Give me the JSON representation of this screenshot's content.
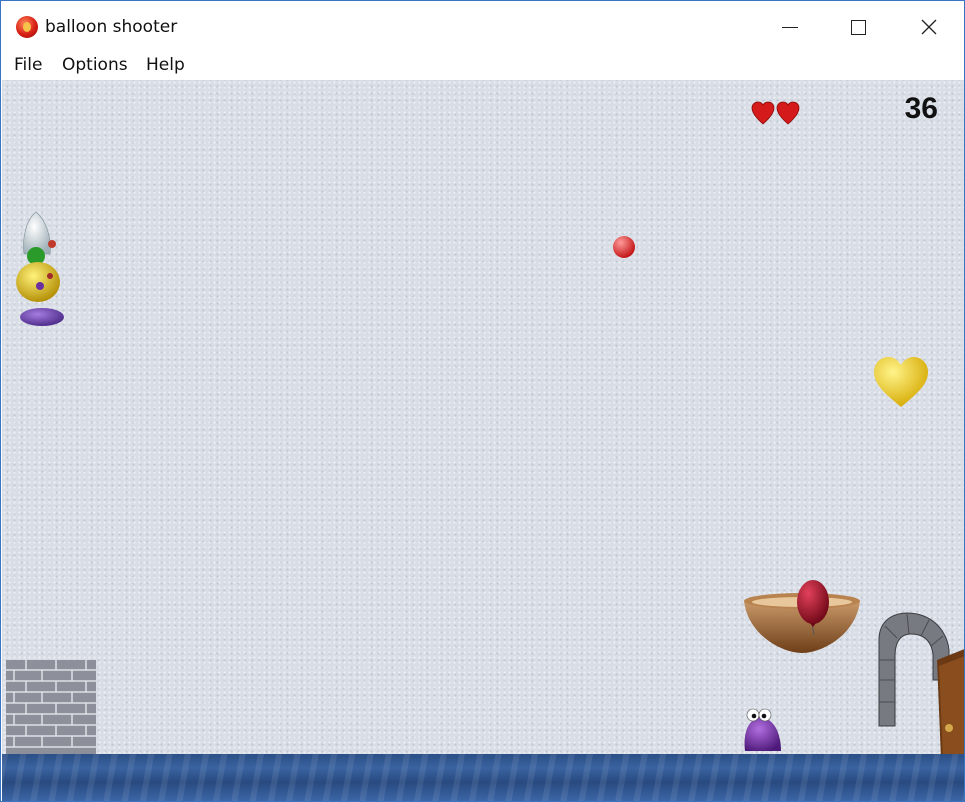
{
  "window": {
    "title": "balloon shooter"
  },
  "menu": [
    "File",
    "Options",
    "Help"
  ],
  "hud": {
    "score": "36",
    "lives": 2
  },
  "colors": {
    "titlebar": "#ffffff",
    "sky": "#d8dde6",
    "water": "#2e5590",
    "heart": "#d41a1a",
    "balloon_yellow": "#f2cf1a",
    "balloon_red": "#a3102a",
    "ball": "#e83a3a"
  }
}
